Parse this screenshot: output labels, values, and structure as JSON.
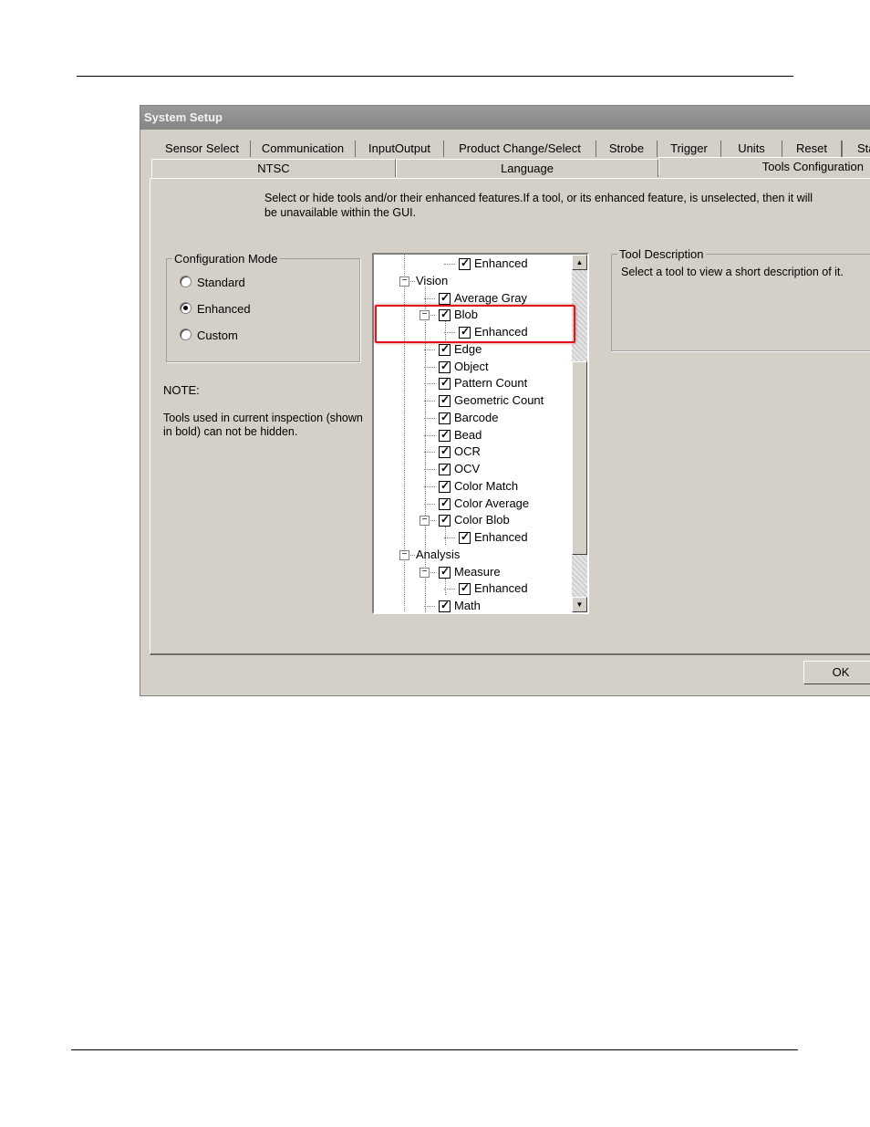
{
  "dialog": {
    "title": "System Setup",
    "tabs_row1": [
      "Sensor Select",
      "Communication",
      "InputOutput",
      "Product Change/Select",
      "Strobe",
      "Trigger",
      "Units",
      "Reset",
      "Sta"
    ],
    "tabs_row2": [
      "NTSC",
      "Language",
      "Tools Configuration"
    ],
    "active_tab": "Tools Configuration",
    "instructions": [
      "Select or hide tools and/or their enhanced features.If a tool, or its enhanced feature, is unselected, then it will",
      "be unavailable within the GUI."
    ],
    "config_mode": {
      "legend": "Configuration Mode",
      "options": [
        "Standard",
        "Enhanced",
        "Custom"
      ],
      "selected": "Enhanced"
    },
    "note": {
      "heading": "NOTE:",
      "lines": [
        "Tools used in current inspection (shown",
        "in bold) can not be hidden."
      ]
    },
    "tree": {
      "items": [
        {
          "label": "Enhanced",
          "checked": true,
          "expander": "none"
        },
        {
          "label": "Vision",
          "checked": null,
          "expander": "minus"
        },
        {
          "label": "Average Gray",
          "checked": true,
          "expander": "none"
        },
        {
          "label": "Blob",
          "checked": true,
          "expander": "minus"
        },
        {
          "label": "Enhanced",
          "checked": true,
          "expander": "none"
        },
        {
          "label": "Edge",
          "checked": true,
          "expander": "none"
        },
        {
          "label": "Object",
          "checked": true,
          "expander": "none"
        },
        {
          "label": "Pattern Count",
          "checked": true,
          "expander": "none"
        },
        {
          "label": "Geometric Count",
          "checked": true,
          "expander": "none"
        },
        {
          "label": "Barcode",
          "checked": true,
          "expander": "none"
        },
        {
          "label": "Bead",
          "checked": true,
          "expander": "none"
        },
        {
          "label": "OCR",
          "checked": true,
          "expander": "none"
        },
        {
          "label": "OCV",
          "checked": true,
          "expander": "none"
        },
        {
          "label": "Color Match",
          "checked": true,
          "expander": "none"
        },
        {
          "label": "Color Average",
          "checked": true,
          "expander": "none"
        },
        {
          "label": "Color Blob",
          "checked": true,
          "expander": "minus"
        },
        {
          "label": "Enhanced",
          "checked": true,
          "expander": "none"
        },
        {
          "label": "Analysis",
          "checked": null,
          "expander": "minus"
        },
        {
          "label": "Measure",
          "checked": true,
          "expander": "minus"
        },
        {
          "label": "Enhanced",
          "checked": true,
          "expander": "none"
        },
        {
          "label": "Math",
          "checked": true,
          "expander": "none"
        }
      ]
    },
    "tool_description": {
      "legend": "Tool Description",
      "text": "Select a tool to view a short description of it."
    },
    "ok_label": "OK",
    "highlight_color": "#e0141a"
  }
}
